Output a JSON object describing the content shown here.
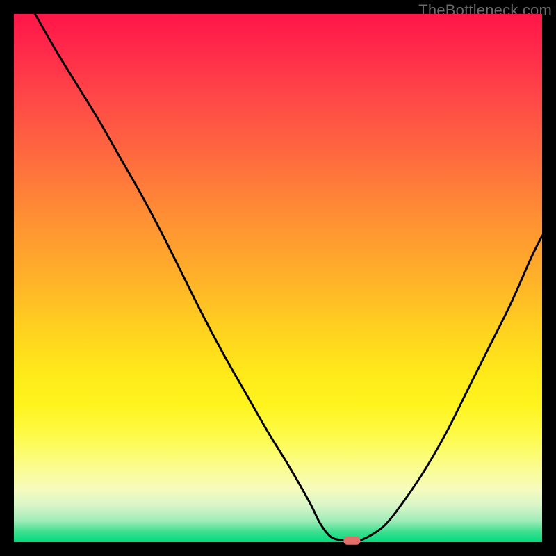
{
  "watermark": "TheBottleneck.com",
  "marker": {
    "color": "#e26f6a"
  },
  "chart_data": {
    "type": "line",
    "title": "",
    "xlabel": "",
    "ylabel": "",
    "xlim": [
      0,
      100
    ],
    "ylim": [
      0,
      100
    ],
    "x": [
      4,
      8,
      12,
      16,
      20,
      24,
      28,
      32,
      36,
      40,
      44,
      48,
      52,
      56,
      58,
      60,
      62,
      64,
      66,
      70,
      74,
      78,
      82,
      86,
      90,
      94,
      98,
      100
    ],
    "y": [
      100,
      93,
      86.5,
      80,
      73,
      66,
      58.5,
      50.5,
      42.5,
      35,
      28,
      21,
      14.5,
      7.5,
      3.5,
      1.0,
      0.4,
      0.3,
      0.5,
      3,
      8,
      14,
      21,
      29,
      37,
      45,
      54,
      58
    ],
    "optimum_x": 64,
    "legend": [],
    "grid": false,
    "background_gradient": [
      "#ff1648",
      "#ffd21f",
      "#fdfb4a",
      "#00db7e"
    ]
  }
}
